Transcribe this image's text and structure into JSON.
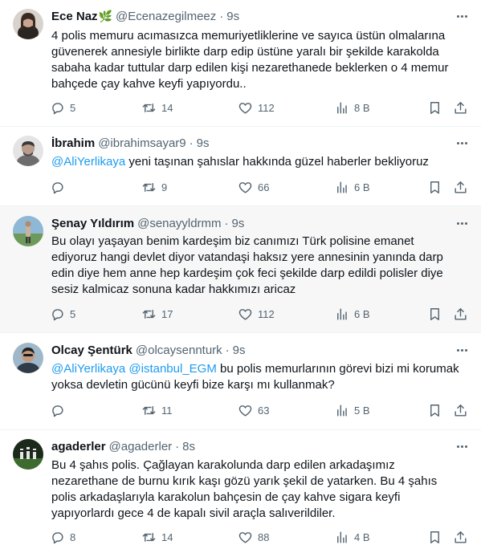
{
  "tweets": [
    {
      "name": "Ece Naz",
      "name_emoji": "🌿",
      "handle": "@Ecenazegilmeez",
      "sep": "·",
      "time": "9s",
      "lines": [
        "4 polis memuru acımasızca memuriyetliklerine ve sayıca üstün olmalarına",
        "güvenerek annesiyle birlikte darp edip üstüne yaralı bir şekilde karakolda",
        "sabaha kadar tuttular darp edilen kişi nezarethanede beklerken o 4 memur",
        "bahçede çay kahve keyfi yapıyordu.."
      ],
      "replies": "5",
      "retweets": "14",
      "likes": "112",
      "views": "8 B"
    },
    {
      "name": "İbrahim",
      "handle": "@ibrahimsayar9",
      "sep": "·",
      "time": "9s",
      "mention1": "@AliYerlikaya",
      "line1_rest": " yeni taşınan şahıslar hakkında güzel haberler bekliyoruz",
      "replies": "",
      "retweets": "9",
      "likes": "66",
      "views": "6 B"
    },
    {
      "name": "Şenay Yıldırım",
      "handle": "@senayyldrmm",
      "sep": "·",
      "time": "9s",
      "lines": [
        "Bu olayı yaşayan benim kardeşim biz canımızı Türk polisine emanet",
        "ediyoruz hangi devlet diyor vatandaşi haksız yere annesinin yanında darp",
        "edin diye hem anne hep kardeşim çok feci şekilde darp edildi polisler diye",
        "sesiz kalmicaz sonuna kadar hakkımızı aricaz"
      ],
      "replies": "5",
      "retweets": "17",
      "likes": "112",
      "views": "6 B"
    },
    {
      "name": "Olcay Şentürk",
      "handle": "@olcaysennturk",
      "sep": "·",
      "time": "9s",
      "mention1": "@AliYerlikaya",
      "mention2": "@istanbul_EGM",
      "line1_rest": " bu polis memurlarının görevi bizi mi korumak",
      "line2": "yoksa devletin gücünü keyfi bize karşı mı kullanmak?",
      "replies": "",
      "retweets": "11",
      "likes": "63",
      "views": "5 B"
    },
    {
      "name": "agaderler",
      "handle": "@agaderler",
      "sep": "·",
      "time": "8s",
      "lines": [
        "Bu 4 şahıs polis. Çağlayan karakolunda darp edilen arkadaşımız",
        "nezarethane de burnu kırık kaşı gözü yarık şekil de yatarken. Bu 4 şahıs",
        "polis arkadaşlarıyla karakolun bahçesin de çay kahve sigara keyfi",
        "yapıyorlardı gece 4 de kapalı sivil araçla salıverildiler."
      ],
      "replies": "8",
      "retweets": "14",
      "likes": "88",
      "views": "4 B"
    }
  ],
  "icons": {
    "reply": "reply-icon",
    "retweet": "retweet-icon",
    "like": "heart-icon",
    "views": "views-icon",
    "bookmark": "bookmark-icon",
    "share": "share-icon",
    "more": "more-icon"
  },
  "colors": {
    "text": "#0f1419",
    "secondary": "#536471",
    "mention": "#1d9bf0",
    "divider": "#eff3f4",
    "hover_bg": "#f7f7f7",
    "leaf": "#19a463"
  }
}
